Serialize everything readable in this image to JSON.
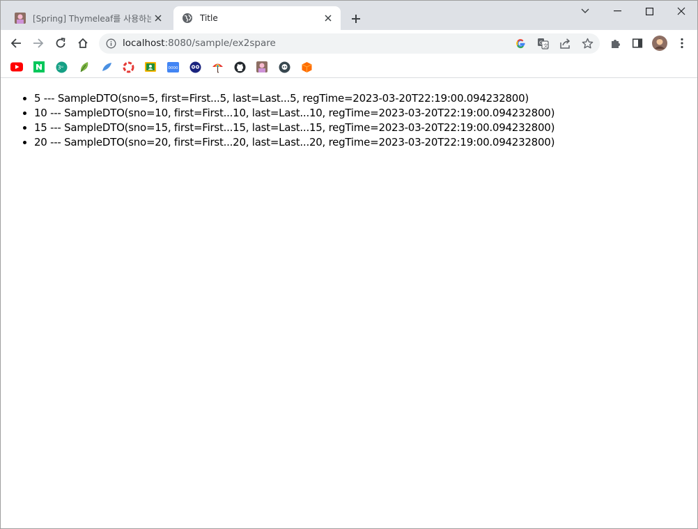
{
  "tabs": [
    {
      "title": "[Spring] Thymeleaf를 사용하는 코드",
      "favicon": "avatar-favicon",
      "active": false
    },
    {
      "title": "Title",
      "favicon": "globe-icon",
      "active": true
    }
  ],
  "toolbar": {
    "url_host": "localhost",
    "url_path": ":8080/sample/ex2spare"
  },
  "bookmarks": [
    {
      "name": "youtube",
      "color": "#ff0000"
    },
    {
      "name": "naver",
      "color": "#03c75a"
    },
    {
      "name": "green-app",
      "color": "#1abc9c"
    },
    {
      "name": "leaf",
      "color": "#6ab04c"
    },
    {
      "name": "feather",
      "color": "#4a90e2"
    },
    {
      "name": "lifebuoy",
      "color": "#e74c3c"
    },
    {
      "name": "classroom",
      "color": "#f4b400"
    },
    {
      "name": "grid-app",
      "color": "#4285f4"
    },
    {
      "name": "owl",
      "color": "#1a237e"
    },
    {
      "name": "umbrella",
      "color": "#e67e22"
    },
    {
      "name": "github",
      "color": "#24292e"
    },
    {
      "name": "avatar",
      "color": "#a0522d"
    },
    {
      "name": "robot",
      "color": "#2c3e50"
    },
    {
      "name": "cube",
      "color": "#ff6d00"
    }
  ],
  "content": {
    "items": [
      "5 --- SampleDTO(sno=5, first=First...5, last=Last...5, regTime=2023-03-20T22:19:00.094232800)",
      "10 --- SampleDTO(sno=10, first=First...10, last=Last...10, regTime=2023-03-20T22:19:00.094232800)",
      "15 --- SampleDTO(sno=15, first=First...15, last=Last...15, regTime=2023-03-20T22:19:00.094232800)",
      "20 --- SampleDTO(sno=20, first=First...20, last=Last...20, regTime=2023-03-20T22:19:00.094232800)"
    ]
  }
}
